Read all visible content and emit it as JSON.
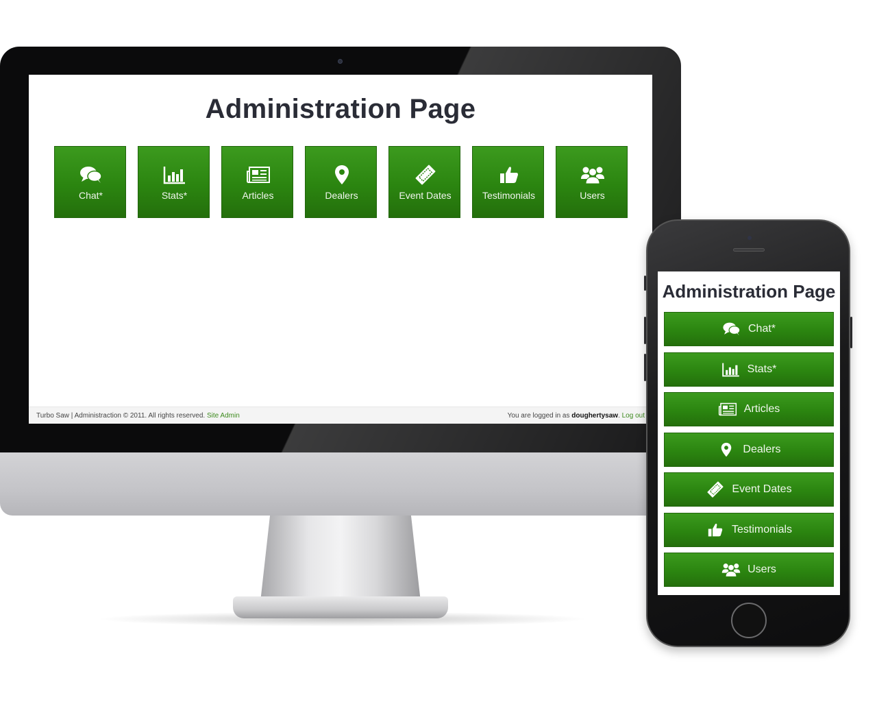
{
  "desktop": {
    "title": "Administration Page",
    "tiles": [
      {
        "label": "Chat*",
        "icon": "chat-icon"
      },
      {
        "label": "Stats*",
        "icon": "bar-chart-icon"
      },
      {
        "label": "Articles",
        "icon": "newspaper-icon"
      },
      {
        "label": "Dealers",
        "icon": "map-marker-icon"
      },
      {
        "label": "Event Dates",
        "icon": "ticket-icon"
      },
      {
        "label": "Testimonials",
        "icon": "thumbs-up-icon"
      },
      {
        "label": "Users",
        "icon": "users-icon"
      }
    ],
    "footer": {
      "left_text": "Turbo Saw | Administraction © 2011. All rights reserved.",
      "site_admin_link": "Site Admin",
      "logged_in_prefix": "You are logged in as",
      "username": "doughertysaw",
      "logout_link": "Log out"
    }
  },
  "mobile": {
    "title": "Administration Page",
    "buttons": [
      {
        "label": "Chat*",
        "icon": "chat-icon"
      },
      {
        "label": "Stats*",
        "icon": "bar-chart-icon"
      },
      {
        "label": "Articles",
        "icon": "newspaper-icon"
      },
      {
        "label": "Dealers",
        "icon": "map-marker-icon"
      },
      {
        "label": "Event Dates",
        "icon": "ticket-icon"
      },
      {
        "label": "Testimonials",
        "icon": "thumbs-up-icon"
      },
      {
        "label": "Users",
        "icon": "users-icon"
      }
    ]
  },
  "colors": {
    "tile_green": "#2b8510",
    "link_green": "#3d8a1e",
    "title_text": "#2a2c36"
  }
}
